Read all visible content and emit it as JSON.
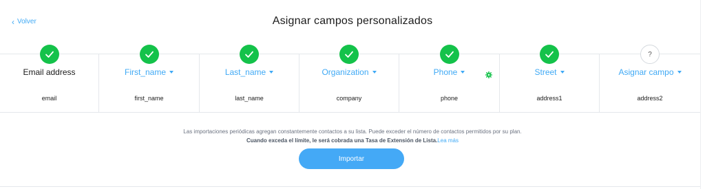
{
  "nav": {
    "back_label": "Volver"
  },
  "header": {
    "title": "Asignar campos personalizados"
  },
  "columns": [
    {
      "field": "Email address",
      "source": "email",
      "status": "done",
      "selectable": false,
      "settings": false
    },
    {
      "field": "First_name",
      "source": "first_name",
      "status": "done",
      "selectable": true,
      "settings": false
    },
    {
      "field": "Last_name",
      "source": "last_name",
      "status": "done",
      "selectable": true,
      "settings": false
    },
    {
      "field": "Organization",
      "source": "company",
      "status": "done",
      "selectable": true,
      "settings": false
    },
    {
      "field": "Phone",
      "source": "phone",
      "status": "done",
      "selectable": true,
      "settings": true
    },
    {
      "field": "Street",
      "source": "address1",
      "status": "done",
      "selectable": true,
      "settings": false
    },
    {
      "field": "Asignar campo",
      "source": "address2",
      "status": "pending",
      "pending_mark": "?",
      "selectable": true,
      "settings": false
    }
  ],
  "notice": {
    "line1": "Las importaciones periódicas agregan constantemente contactos a su lista. Puede exceder el número de contactos permitidos por su plan.",
    "line2": "Cuando exceda el límite, le será cobrada una Tasa de Extensión de Lista.",
    "more_link": "Lea más"
  },
  "actions": {
    "import_label": "Importar"
  },
  "colors": {
    "accent": "#3fa9f5",
    "success": "#14c24a",
    "button": "#44a9f6"
  },
  "icons": {
    "back": "chevron-left-icon",
    "done": "check-icon",
    "settings": "gear-icon",
    "dropdown": "caret-down-icon"
  }
}
